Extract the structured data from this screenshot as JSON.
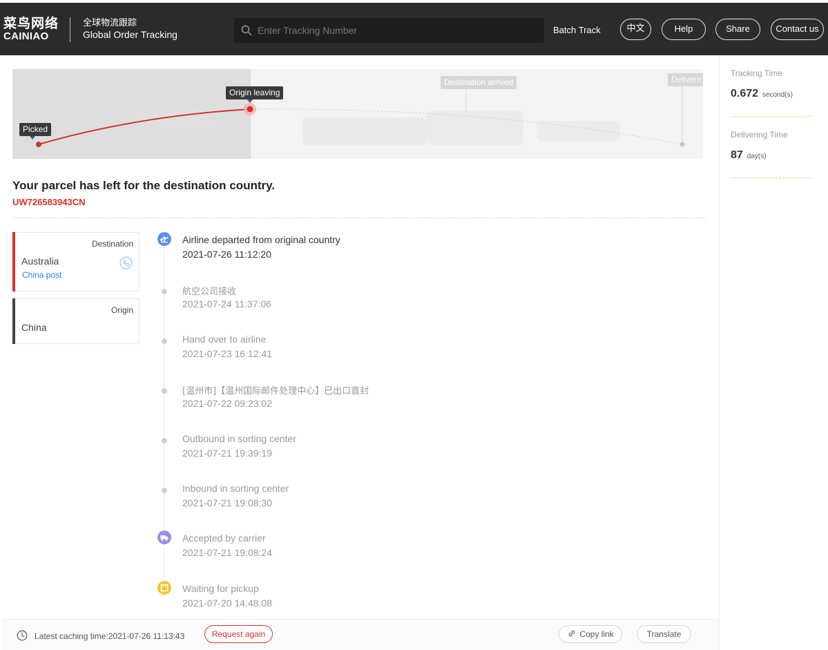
{
  "header": {
    "logo_cn": "菜鸟网络",
    "logo_en": "CAINIAO",
    "subtitle_cn": "全球物流跟踪",
    "subtitle_en": "Global Order Tracking",
    "search_placeholder": "Enter Tracking Number",
    "batch_track": "Batch Track",
    "lang_button": "中文",
    "help_button": "Help",
    "share_button": "Share",
    "contact_button": "Contact us"
  },
  "progress": {
    "stage_picked": "Picked",
    "stage_origin_leaving": "Origin leaving",
    "stage_destination_arrived": "Destination arrived",
    "stage_delivered": "Delivere",
    "colors": {
      "done": "#d0342c",
      "pending": "#cccccc"
    }
  },
  "status": {
    "title": "Your parcel has left for the destination country.",
    "tracking_number": "UW726583943CN"
  },
  "destination": {
    "label": "Destination",
    "country": "Australia",
    "carrier": "China post",
    "color": "#d0342c"
  },
  "origin": {
    "label": "Origin",
    "country": "China",
    "color": "#444444"
  },
  "events": [
    {
      "title": "Airline departed from original country",
      "time": "2021-07-26 11:12:20",
      "icon": "airplane-icon"
    },
    {
      "title": "航空公司接收",
      "time": "2021-07-24 11:37:06"
    },
    {
      "title": "Hand over to airline",
      "time": "2021-07-23 16:12:41"
    },
    {
      "title": "[温州市]【温州国际邮件处理中心】已出口直封",
      "time": "2021-07-22 09:23:02"
    },
    {
      "title": "Outbound in sorting center",
      "time": "2021-07-21 19:39:19"
    },
    {
      "title": "Inbound in sorting center",
      "time": "2021-07-21 19:08:30"
    },
    {
      "title": "Accepted by carrier",
      "time": "2021-07-21 19:08:24",
      "icon": "truck-icon"
    },
    {
      "title": "Waiting for pickup",
      "time": "2021-07-20 14:48:08",
      "icon": "package-icon"
    }
  ],
  "stats": {
    "tracking_time_label": "Tracking Time",
    "tracking_time_value": "0.672",
    "tracking_time_unit": "second(s)",
    "delivering_time_label": "Delivering Time",
    "delivering_time_value": "87",
    "delivering_time_unit": "day(s)"
  },
  "footer": {
    "cache_text": "Latest caching time:2021-07-26 11:13:43",
    "request_again": "Request again",
    "copy_link": "Copy link",
    "translate": "Translate"
  }
}
